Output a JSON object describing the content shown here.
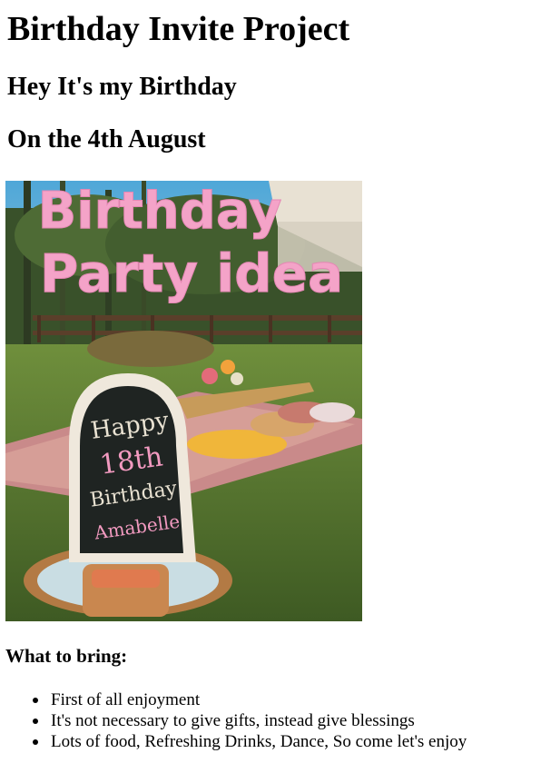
{
  "page": {
    "title": "Birthday Invite Project",
    "greeting": "Hey It's my Birthday",
    "date_line": "On the 4th August"
  },
  "photo": {
    "overlay_line1": "Birthday",
    "overlay_line2": "Party idea",
    "sign_line1": "Happy",
    "sign_line2": "18th",
    "sign_line3": "Birthday",
    "sign_line4": "Amabelle"
  },
  "bring": {
    "heading": "What to bring:",
    "items": [
      "First of all enjoyment",
      "It's not necessary to give gifts, instead give blessings",
      "Lots of food, Refreshing Drinks, Dance, So come let's enjoy"
    ]
  },
  "colors": {
    "overlay_text": "#f4a3c8",
    "grass": "#5b7a3a",
    "sky": "#6fb3d8"
  }
}
